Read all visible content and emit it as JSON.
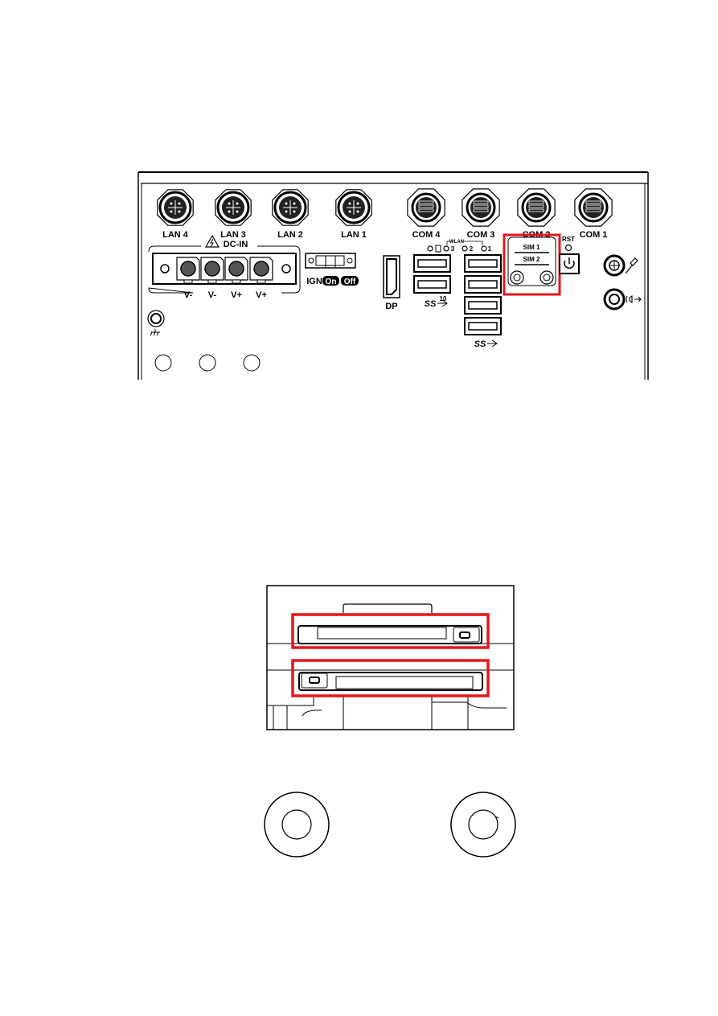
{
  "front_panel": {
    "lan_ports": [
      "LAN 4",
      "LAN 3",
      "LAN 2",
      "LAN 1"
    ],
    "com_ports": [
      "COM 4",
      "COM 3",
      "COM 2",
      "COM 1"
    ],
    "dc_in": {
      "title": "DC-IN",
      "terminals": [
        "V-",
        "V-",
        "V+",
        "V+"
      ]
    },
    "ignition": {
      "label": "IGN",
      "on": "On",
      "off": "Off"
    },
    "display_port": "DP",
    "usb_left_label": "10",
    "wlan": {
      "label": "WLAN",
      "leds": [
        "3",
        "2",
        "1"
      ]
    },
    "sim": {
      "slot1": "SIM 1",
      "slot2": "SIM 2"
    },
    "reset_label": "RST",
    "highlight_color": "#e8141b"
  },
  "sim_tray_view": {
    "highlight_color": "#e8141b"
  }
}
